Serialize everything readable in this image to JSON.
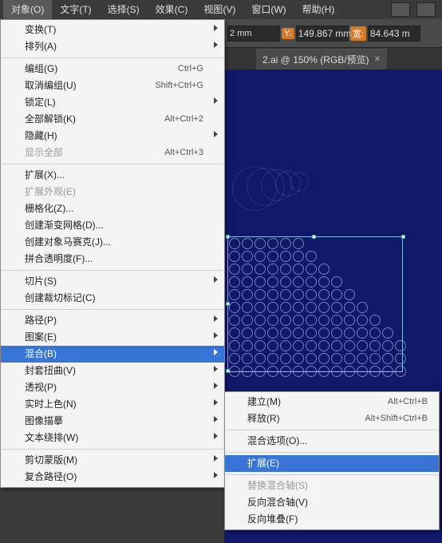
{
  "menubar": {
    "items": [
      "对象(O)",
      "文字(T)",
      "选择(S)",
      "效果(C)",
      "视图(V)",
      "窗口(W)",
      "帮助(H)"
    ]
  },
  "toolbar": {
    "yval": "149.867",
    "ylabel": "Y:",
    "unit1": "mm",
    "wlabel": "宽:",
    "wval": "84.643",
    "unit2": "m",
    "x_unit_frag": "2 mm"
  },
  "tab": {
    "name": "2.ai @ 150% (RGB/预览)"
  },
  "menu1": {
    "g1": [
      {
        "label": "变换(T)",
        "sub": true
      },
      {
        "label": "排列(A)",
        "sub": true
      }
    ],
    "g2": [
      {
        "label": "编组(G)",
        "shortcut": "Ctrl+G"
      },
      {
        "label": "取消编组(U)",
        "shortcut": "Shift+Ctrl+G"
      },
      {
        "label": "锁定(L)",
        "sub": true
      },
      {
        "label": "全部解锁(K)",
        "shortcut": "Alt+Ctrl+2"
      },
      {
        "label": "隐藏(H)",
        "sub": true
      },
      {
        "label": "显示全部",
        "shortcut": "Alt+Ctrl+3",
        "disabled": true
      }
    ],
    "g3": [
      {
        "label": "扩展(X)..."
      },
      {
        "label": "扩展外观(E)",
        "disabled": true
      },
      {
        "label": "栅格化(Z)..."
      },
      {
        "label": "创建渐变网格(D)..."
      },
      {
        "label": "创建对象马赛克(J)..."
      },
      {
        "label": "拼合透明度(F)..."
      }
    ],
    "g4": [
      {
        "label": "切片(S)",
        "sub": true
      },
      {
        "label": "创建裁切标记(C)"
      }
    ],
    "g5": [
      {
        "label": "路径(P)",
        "sub": true
      },
      {
        "label": "图案(E)",
        "sub": true
      },
      {
        "label": "混合(B)",
        "sub": true,
        "hi": true
      },
      {
        "label": "封套扭曲(V)",
        "sub": true
      },
      {
        "label": "透视(P)",
        "sub": true
      },
      {
        "label": "实时上色(N)",
        "sub": true
      },
      {
        "label": "图像描摹",
        "sub": true
      },
      {
        "label": "文本绕排(W)",
        "sub": true
      }
    ],
    "g6": [
      {
        "label": "剪切蒙版(M)",
        "sub": true
      },
      {
        "label": "复合路径(O)",
        "sub": true
      }
    ]
  },
  "menu2": {
    "g1": [
      {
        "label": "建立(M)",
        "shortcut": "Alt+Ctrl+B"
      },
      {
        "label": "释放(R)",
        "shortcut": "Alt+Shift+Ctrl+B"
      }
    ],
    "g2": [
      {
        "label": "混合选项(O)..."
      }
    ],
    "g3": [
      {
        "label": "扩展(E)",
        "hi": true
      }
    ],
    "g4": [
      {
        "label": "替换混合轴(S)",
        "disabled": true
      },
      {
        "label": "反向混合轴(V)"
      },
      {
        "label": "反向堆叠(F)"
      }
    ]
  }
}
